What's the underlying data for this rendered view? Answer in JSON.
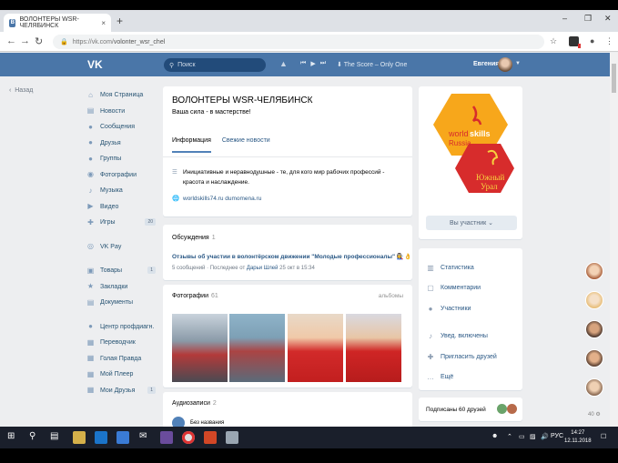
{
  "browser": {
    "tab_title": "ВОЛОНТЕРЫ WSR-ЧЕЛЯБИНСК",
    "tab_close": "×",
    "new_tab": "+",
    "url_host": "https://vk.com/",
    "url_path": "volonter_wsr_chel"
  },
  "header": {
    "logo": "VK",
    "search_placeholder": "Поиск",
    "track": "The Score – Only One",
    "user_name": "Евгения"
  },
  "left_nav": {
    "back": "Назад",
    "items": [
      {
        "label": "Моя Страница",
        "icon": "house-icon"
      },
      {
        "label": "Новости",
        "icon": "news-icon"
      },
      {
        "label": "Сообщения",
        "icon": "chat-icon"
      },
      {
        "label": "Друзья",
        "icon": "person-icon"
      },
      {
        "label": "Группы",
        "icon": "people-icon"
      },
      {
        "label": "Фотографии",
        "icon": "camera-icon"
      },
      {
        "label": "Музыка",
        "icon": "note-icon"
      },
      {
        "label": "Видео",
        "icon": "video-icon"
      },
      {
        "label": "Игры",
        "icon": "gamepad-icon",
        "count": "20"
      },
      {
        "label": "VK Pay",
        "icon": "pay-icon"
      },
      {
        "label": "Товары",
        "icon": "bag-icon",
        "count": "1"
      },
      {
        "label": "Закладки",
        "icon": "star-icon"
      },
      {
        "label": "Документы",
        "icon": "doc-icon"
      },
      {
        "label": "Центр профдиагн.",
        "icon": "people-icon"
      },
      {
        "label": "Переводчик",
        "icon": "app-icon"
      },
      {
        "label": "Голая Правда",
        "icon": "app-icon"
      },
      {
        "label": "Мой Плеер",
        "icon": "app-icon"
      },
      {
        "label": "Мои Друзья",
        "icon": "app-icon",
        "count": "1"
      }
    ]
  },
  "group": {
    "title": "ВОЛОНТЕРЫ WSR-ЧЕЛЯБИНСК",
    "status": "Ваша сила - в мастерстве!",
    "tab_info": "Информация",
    "tab_news": "Свежие новости",
    "description_line1": "Инициативные и неравнодушные - те, для кого мир рабочих профессий -",
    "description_line2": "красота и наслаждение.",
    "website": "worldskills74.ru dumomena.ru"
  },
  "discussions": {
    "title": "Обсуждения",
    "count": "1",
    "topic": "Отзывы об участии в волонтёрском движении \"Молодые профессионалы\" 👩‍🏭👌",
    "meta_prefix": "5 сообщений  ·  Последнее от ",
    "meta_author": "Дарьи Шлей",
    "meta_suffix": " 25 окт в 15:34"
  },
  "photos": {
    "title": "Фотографии",
    "count": "61",
    "albums": "альбомы"
  },
  "audio": {
    "title": "Аудиозаписи",
    "count": "2",
    "first_track": "Без названия"
  },
  "right": {
    "logo_world": "world",
    "logo_skills": "skills",
    "logo_russia": "Russia",
    "logo_region1": "Южный",
    "logo_region2": "Урал",
    "member_button": "Вы участник ⌄",
    "links": [
      "Статистика",
      "Комментарии",
      "Участники",
      "Увед. включены",
      "Пригласить друзей",
      "Ещё"
    ],
    "friends": "Подписаны 60 друзей"
  },
  "chat_footer": "40",
  "taskbar": {
    "lang": "РУС",
    "time": "14:27",
    "date": "12.11.2018"
  },
  "colors": {
    "vk_blue": "#4a76a8",
    "link": "#2a5885",
    "worldskills_orange": "#f7a71b",
    "worldskills_red": "#d72c2c"
  }
}
